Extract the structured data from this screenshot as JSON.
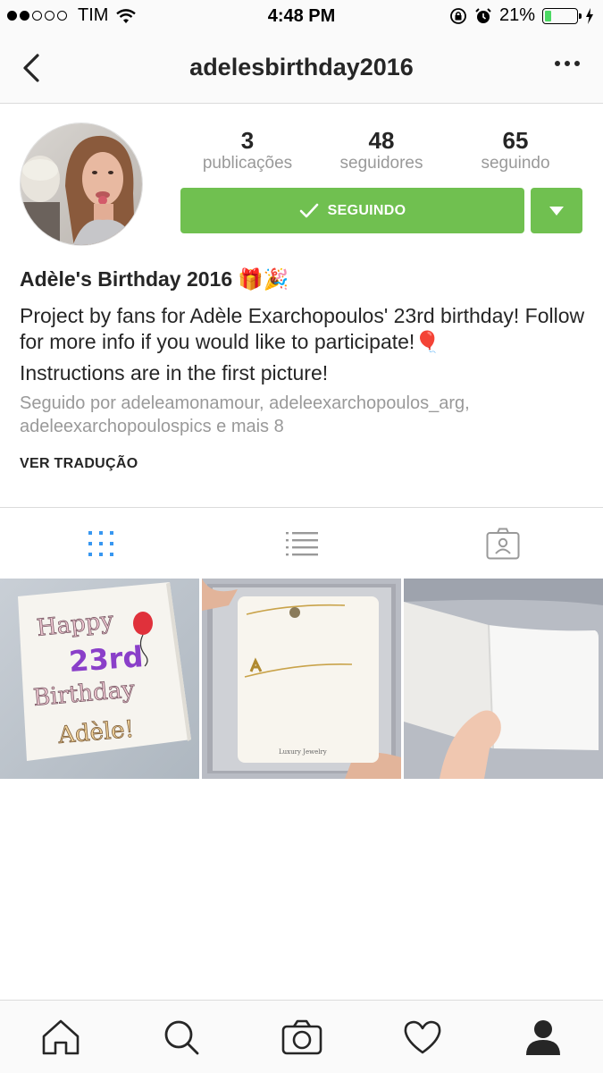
{
  "status_bar": {
    "carrier": "TIM",
    "time": "4:48 PM",
    "battery_pct": "21%",
    "battery_level": 0.21,
    "signal_bars_filled": 2,
    "signal_bars_total": 5,
    "battery_color": "#4cd964"
  },
  "nav": {
    "title": "adelesbirthday2016",
    "back_icon": "chevron-left-icon",
    "more_icon": "more-horizontal-icon"
  },
  "profile": {
    "stats": [
      {
        "value": "3",
        "label": "publicações"
      },
      {
        "value": "48",
        "label": "seguidores"
      },
      {
        "value": "65",
        "label": "seguindo"
      }
    ],
    "follow_button": "SEGUINDO",
    "accent_color": "#70c050"
  },
  "bio": {
    "name": "Adèle's Birthday 2016",
    "name_emoji": "🎁🎉",
    "line1": "Project by fans for Adèle Exarchopoulos' 23rd birthday! Follow for more info if you would like to participate!",
    "line1_emoji": "🎈",
    "line2": "Instructions are in the first picture!",
    "followed_by": "Seguido por adeleamonamour, adeleexarchopoulos_arg, adeleexarchopoulospics e mais 8",
    "translate": "VER TRADUÇÃO"
  },
  "tabs": [
    {
      "name": "grid-view-icon",
      "active": true
    },
    {
      "name": "list-view-icon",
      "active": false
    },
    {
      "name": "tagged-photos-icon",
      "active": false
    }
  ],
  "posts": [
    {
      "text_lines": [
        "Happy",
        "23rd",
        "Birthday",
        "Adèle!"
      ]
    },
    {
      "caption": "Luxury Jewelry"
    },
    {}
  ],
  "tab_bar": [
    "home-icon",
    "search-icon",
    "camera-icon",
    "heart-icon",
    "profile-icon"
  ]
}
